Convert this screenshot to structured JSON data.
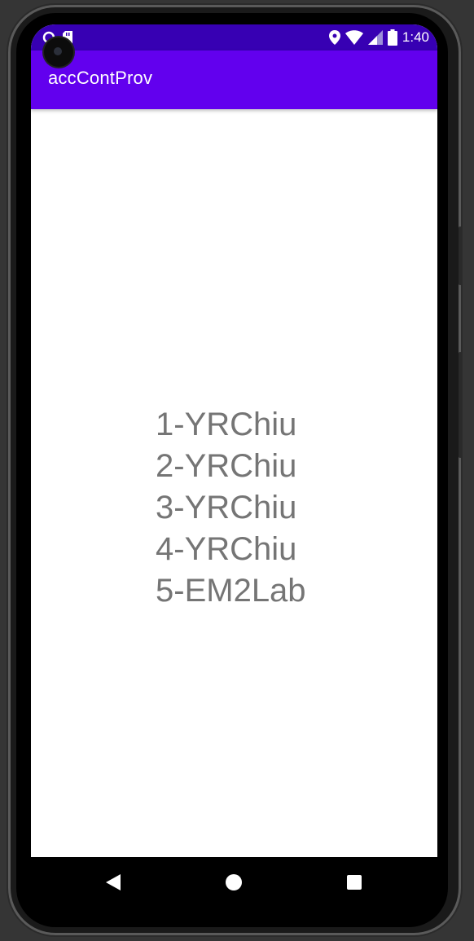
{
  "status_bar": {
    "time": "1:40",
    "icons": [
      "sync-icon",
      "sd-card-icon",
      "location-icon",
      "wifi-icon",
      "signal-icon",
      "battery-icon"
    ]
  },
  "app_bar": {
    "title": "accContProv"
  },
  "content": {
    "lines": [
      "1-YRChiu",
      "2-YRChiu",
      "3-YRChiu",
      "4-YRChiu",
      "5-EM2Lab"
    ]
  },
  "nav_bar": {
    "buttons": [
      "back-icon",
      "home-icon",
      "recents-icon"
    ]
  },
  "colors": {
    "status_bar": "#3700b3",
    "app_bar": "#6200ee",
    "text": "#757575"
  }
}
